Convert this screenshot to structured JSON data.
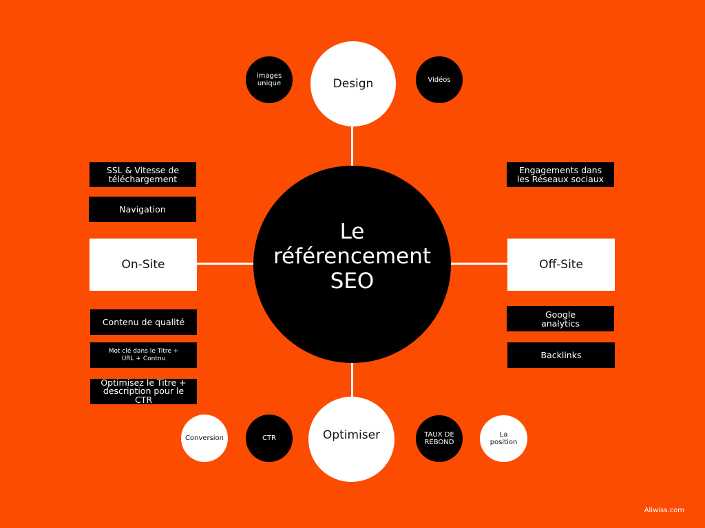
{
  "colors": {
    "background": "#fc4c02",
    "dark_node": "#000000",
    "light_node": "#ffffff"
  },
  "hub": {
    "lines": [
      "Le",
      "référencement",
      "SEO"
    ]
  },
  "top": {
    "main": "Design",
    "left": [
      "images",
      "unique"
    ],
    "right": "Vidéos"
  },
  "left": {
    "main": "On-Site",
    "above": [
      [
        "SSL & Vitesse de",
        "téléchargement"
      ],
      [
        "Navigation"
      ]
    ],
    "below": [
      [
        "Contenu de qualité"
      ],
      [
        "Mot clé dans le Titre +",
        "URL + Contnu"
      ],
      [
        "Optimisez le Titre +",
        "description pour le",
        "CTR"
      ]
    ]
  },
  "right": {
    "main": "Off-Site",
    "above": [
      [
        "Engagements dans",
        "les Réseaux sociaux"
      ]
    ],
    "below": [
      [
        "Google",
        "analytics"
      ],
      [
        "Backlinks"
      ]
    ]
  },
  "bottom": {
    "main": "Optimiser",
    "left": [
      "Conversion",
      "CTR"
    ],
    "right": [
      [
        "TAUX DE",
        "REBOND"
      ],
      [
        "La",
        "position"
      ]
    ]
  },
  "footer": "Aliwiss.com"
}
